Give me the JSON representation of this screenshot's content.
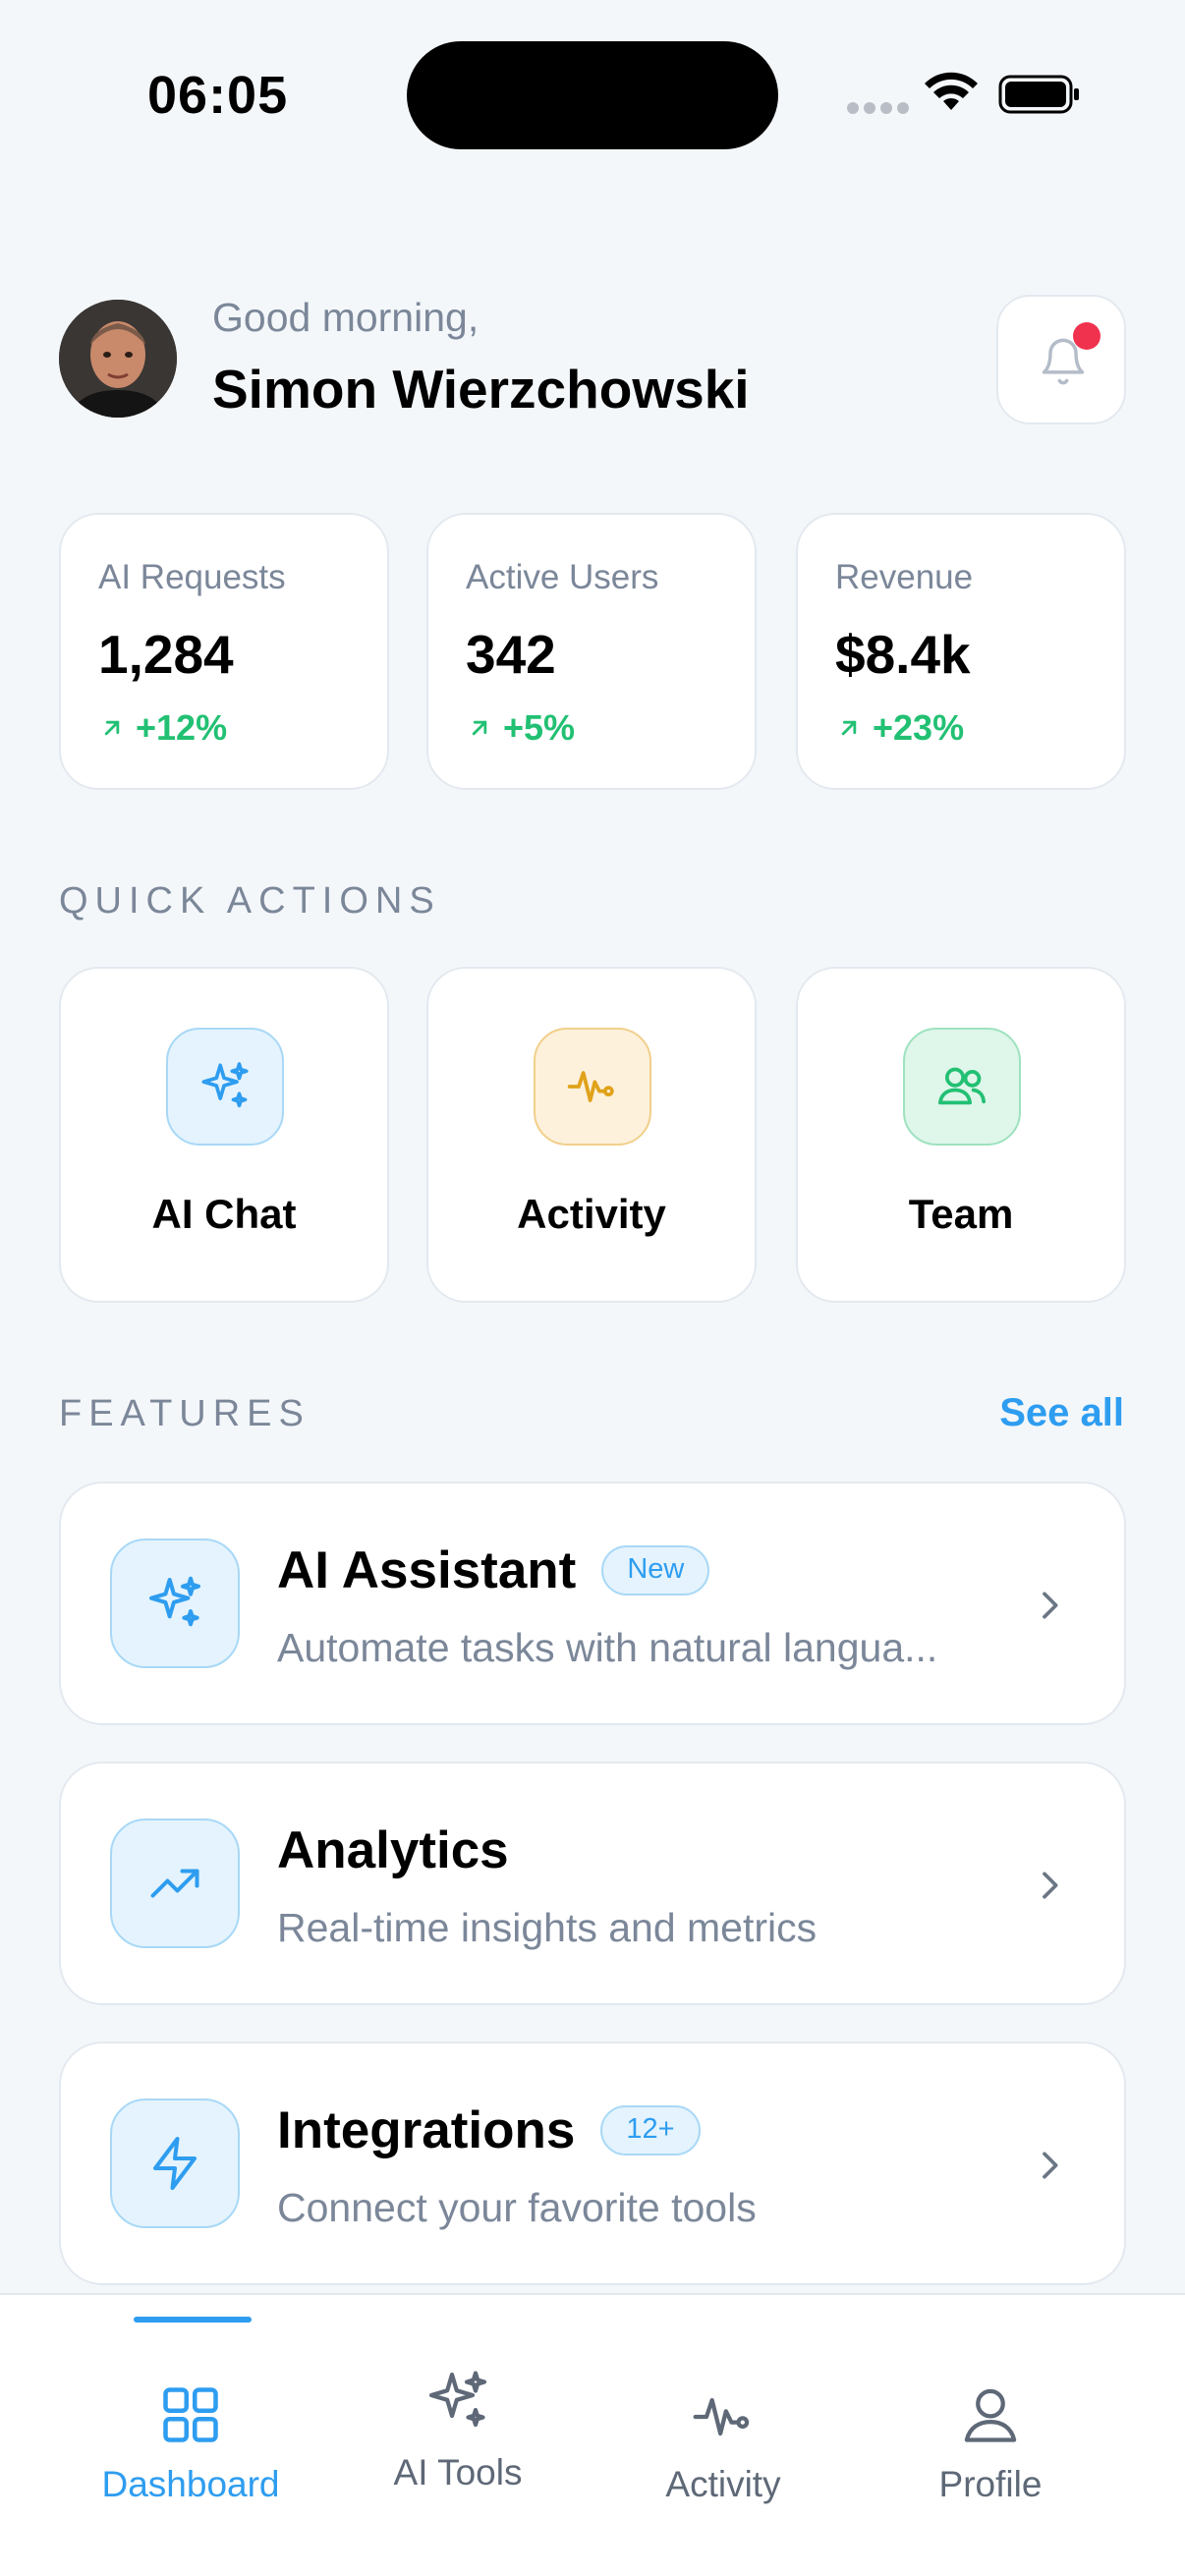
{
  "status_bar": {
    "time": "06:05"
  },
  "header": {
    "greeting": "Good morning,",
    "user_name": "Simon Wierzchowski"
  },
  "stats": [
    {
      "label": "AI Requests",
      "value": "1,284",
      "delta": "+12%"
    },
    {
      "label": "Active Users",
      "value": "342",
      "delta": "+5%"
    },
    {
      "label": "Revenue",
      "value": "$8.4k",
      "delta": "+23%"
    }
  ],
  "quick_actions": {
    "title": "QUICK ACTIONS",
    "items": [
      {
        "label": "AI Chat",
        "icon": "sparkles-icon",
        "color": "#2e9df0"
      },
      {
        "label": "Activity",
        "icon": "activity-icon",
        "color": "#e0a21a"
      },
      {
        "label": "Team",
        "icon": "users-icon",
        "color": "#22c073"
      }
    ]
  },
  "features": {
    "title": "FEATURES",
    "see_all": "See all",
    "items": [
      {
        "title": "AI Assistant",
        "badge": "New",
        "description": "Automate tasks with natural langua...",
        "icon": "sparkles-icon"
      },
      {
        "title": "Analytics",
        "badge": "",
        "description": "Real-time insights and metrics",
        "icon": "trending-up-icon"
      },
      {
        "title": "Integrations",
        "badge": "12+",
        "description": "Connect your favorite tools",
        "icon": "lightning-icon"
      }
    ]
  },
  "tab_bar": {
    "items": [
      {
        "label": "Dashboard",
        "icon": "grid-icon",
        "active": true
      },
      {
        "label": "AI Tools",
        "icon": "sparkles-icon",
        "active": false
      },
      {
        "label": "Activity",
        "icon": "activity-icon",
        "active": false
      },
      {
        "label": "Profile",
        "icon": "person-icon",
        "active": false
      }
    ]
  },
  "colors": {
    "accent": "#2e9df0",
    "positive": "#22c073",
    "notification": "#f0324f",
    "muted_text": "#7b8799"
  }
}
